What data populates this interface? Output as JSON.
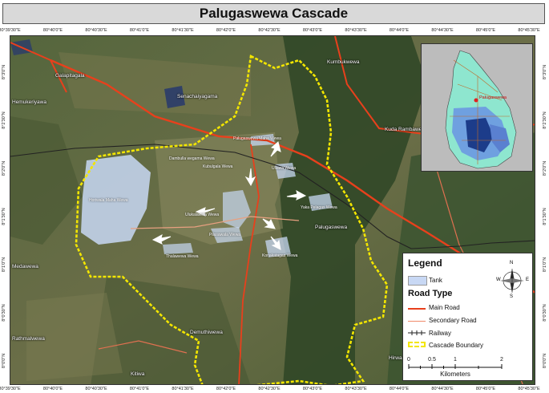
{
  "title": "Palugaswewa Cascade",
  "grid_top_labels": [
    "80°39'30\"E",
    "80°40'0\"E",
    "80°40'30\"E",
    "80°41'0\"E",
    "80°41'30\"E",
    "80°42'0\"E",
    "80°42'30\"E",
    "80°43'0\"E",
    "80°43'30\"E",
    "80°44'0\"E",
    "80°44'30\"E",
    "80°45'0\"E",
    "80°45'30\"E"
  ],
  "grid_bottom_labels": [
    "80°39'30\"E",
    "80°40'0\"E",
    "80°40'30\"E",
    "80°41'0\"E",
    "80°41'30\"E",
    "80°42'0\"E",
    "80°42'30\"E",
    "80°43'0\"E",
    "80°43'30\"E",
    "80°44'0\"E",
    "80°44'30\"E",
    "80°45'0\"E",
    "80°45'30\"E"
  ],
  "grid_left_labels": [
    "8°3'0\"N",
    "8°2'30\"N",
    "8°2'0\"N",
    "8°1'30\"N",
    "8°1'0\"N",
    "8°0'30\"N",
    "8°0'0\"N"
  ],
  "grid_right_labels": [
    "8°3'0\"N",
    "8°2'30\"N",
    "8°2'0\"N",
    "8°1'30\"N",
    "8°1'0\"N",
    "8°0'30\"N",
    "8°0'0\"N"
  ],
  "places": {
    "galapitagala": "Galapitagala",
    "hemukeriyawa": "Hemukeriyawa",
    "senachaiyagama": "Senachaiyagama",
    "kumbukwewa": "Kumbukwewa",
    "kuda_rambawewa": "Kuda Rambawewa",
    "palugaswewa": "Palugaswewa",
    "medawewa": "Medawewa",
    "rathmalwewa": "Rathmalwewa",
    "demuthiwewa": "Demuthiwewa",
    "kitiwa": "Kitiwa",
    "hirwa": "Hirwa"
  },
  "tanks": {
    "palugaswewa_maha": "Palugaswewa Maha Wewa",
    "dambulla_wegama": "Dambulla wegama Wewa",
    "kubulgala": "Kubulgala Wewa",
    "ullawa": "Ullawa Wewa",
    "horiwala_maha": "Horiwala Maha Wewa",
    "ulukalawela": "Ulukalawela Wewa",
    "yaka_pelagas": "Yaka Pelagas Wewa",
    "pilasawala": "Pilasawala Wewa",
    "konakatagas": "Konakatagas Wewa",
    "thalawewa": "Thalawewa Wewa"
  },
  "inset": {
    "label": "Palugaswewa"
  },
  "legend": {
    "title": "Legend",
    "tank_label": "Tank",
    "road_type_title": "Road Type",
    "main_road": "Main Road",
    "secondary_road": "Secondary Road",
    "railway": "Railway",
    "cascade_boundary": "Cascade Boundary",
    "compass": {
      "n": "N",
      "s": "S",
      "e": "E",
      "w": "W"
    }
  },
  "scale": {
    "ticks": [
      "0",
      "0.5",
      "1",
      "2"
    ],
    "unit": "Kilometers"
  },
  "colors": {
    "main_road": "#e8401c",
    "secondary_road": "#f08a6a",
    "railway": "#222222",
    "boundary": "#f3e600",
    "tank": "#c8d8f4",
    "vegetation_dark": "#2f4a2a",
    "vegetation_mid": "#5a6e3e",
    "fields": "#8a8a5a"
  }
}
